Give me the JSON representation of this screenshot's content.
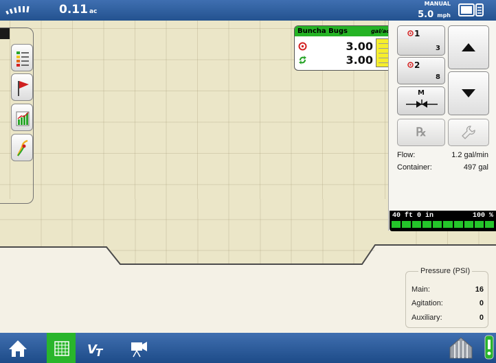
{
  "status_bar": {
    "area_value": "0.11",
    "area_unit": "ac",
    "speed_mode": "MANUAL",
    "speed_value": "5.0",
    "speed_unit": "mph",
    "icons": [
      "gps-signal-icon",
      "display-layout-icon"
    ]
  },
  "product": {
    "name": "Buncha Bugs",
    "unit": "gal/ac",
    "target_rate": "3.00",
    "actual_rate": "3.00",
    "tank_fill_fraction": 1.0,
    "accent_color": "#25b325"
  },
  "controls": {
    "rate1": {
      "label": "1",
      "count": "3"
    },
    "rate2": {
      "label": "2",
      "count": "8"
    },
    "mode_label": "M",
    "rx_label": "℞"
  },
  "info": {
    "flow_label": "Flow:",
    "flow_value": "1.2 gal/min",
    "container_label": "Container:",
    "container_value": "497 gal"
  },
  "boom": {
    "width": "40 ft 0 in",
    "coverage": "100 %",
    "sections_on": 10,
    "section_color": "#24c52a"
  },
  "pressure": {
    "title": "Pressure (PSI)",
    "rows": [
      {
        "label": "Main:",
        "value": "16"
      },
      {
        "label": "Agitation:",
        "value": "0"
      },
      {
        "label": "Auxiliary:",
        "value": "0"
      }
    ]
  },
  "map_tools": [
    "layers-icon",
    "flag-icon",
    "chart-icon",
    "guidance-icon"
  ],
  "nav": {
    "items": [
      "home-icon",
      "map-grid-icon",
      "vt-icon",
      "camera-icon"
    ],
    "active": "map-grid-icon"
  }
}
